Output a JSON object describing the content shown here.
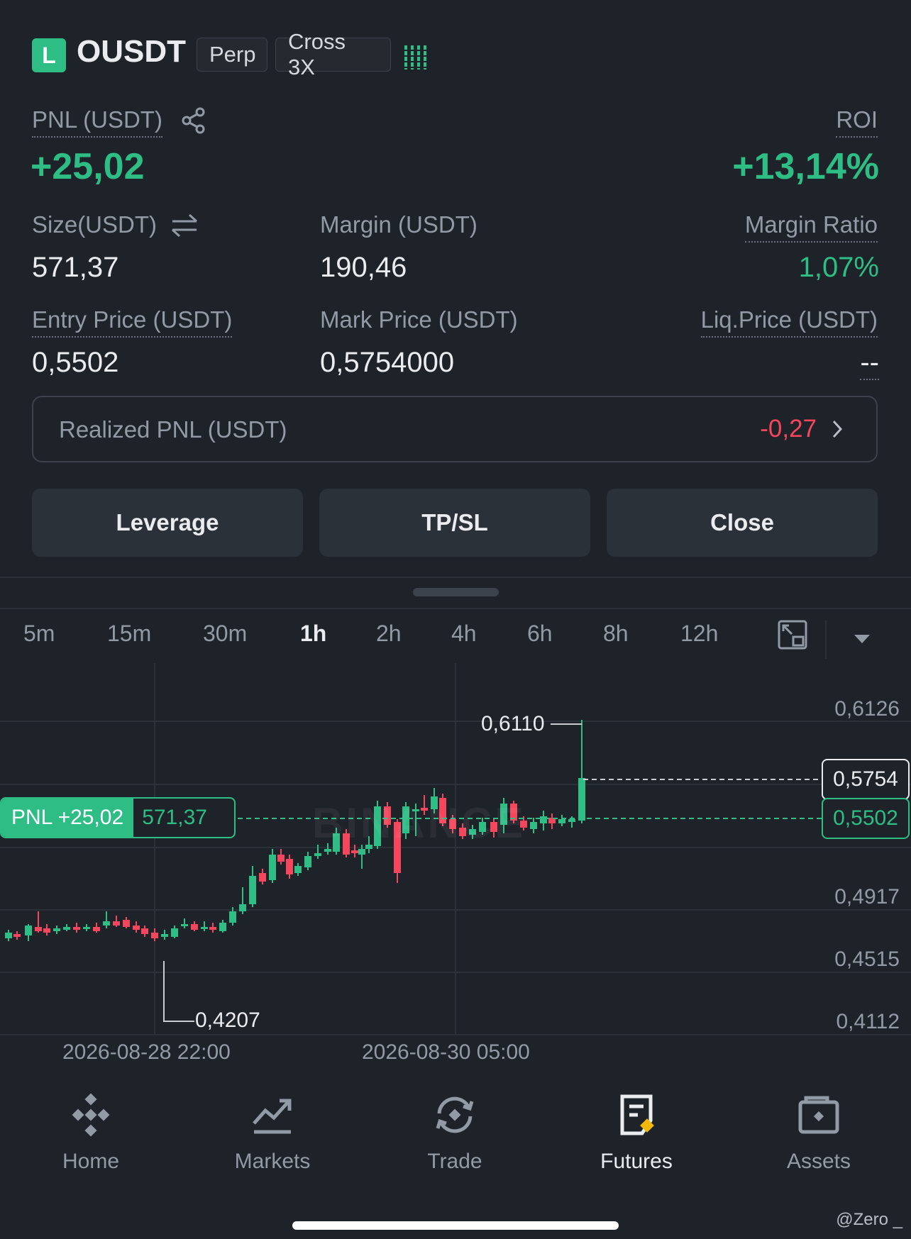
{
  "header": {
    "badge": "L",
    "symbol": "OUSDT",
    "tag_perp": "Perp",
    "tag_cross": "Cross 3X"
  },
  "pnl": {
    "label": "PNL (USDT)",
    "value": "+25,02"
  },
  "roi": {
    "label": "ROI",
    "value": "+13,14%"
  },
  "size": {
    "label": "Size(USDT)",
    "value": "571,37"
  },
  "margin": {
    "label": "Margin (USDT)",
    "value": "190,46"
  },
  "margin_ratio": {
    "label": "Margin Ratio",
    "value": "1,07%"
  },
  "entry_price": {
    "label": "Entry Price (USDT)",
    "value": "0,5502"
  },
  "mark_price": {
    "label": "Mark Price (USDT)",
    "value": "0,5754000"
  },
  "liq_price": {
    "label": "Liq.Price (USDT)",
    "value": "--"
  },
  "realized": {
    "label": "Realized PNL (USDT)",
    "value": "-0,27"
  },
  "buttons": {
    "leverage": "Leverage",
    "tpsl": "TP/SL",
    "close": "Close"
  },
  "timeframes": [
    "5m",
    "15m",
    "30m",
    "1h",
    "2h",
    "4h",
    "6h",
    "8h",
    "12h"
  ],
  "active_timeframe": "1h",
  "chart": {
    "price_axis": [
      "0,6126",
      "0,4917",
      "0,4515",
      "0,4112"
    ],
    "time_axis": [
      "2026-08-28 22:00",
      "2026-08-30 05:00"
    ],
    "high_label": "0,6110",
    "low_label": "0,4207",
    "mark_price_tag": "0,5754",
    "entry_price_tag": "0,5502",
    "pnl_tag_label": "PNL +25,02",
    "pnl_tag_size": "571,37",
    "watermark": "BINANCE"
  },
  "nav": [
    {
      "label": "Home",
      "icon": "home-icon"
    },
    {
      "label": "Markets",
      "icon": "markets-icon"
    },
    {
      "label": "Trade",
      "icon": "trade-icon"
    },
    {
      "label": "Futures",
      "icon": "futures-icon"
    },
    {
      "label": "Assets",
      "icon": "assets-icon"
    }
  ],
  "credit": "@Zero _",
  "colors": {
    "up": "#2ebd85",
    "down": "#f6465d",
    "bg": "#1e2329"
  }
}
